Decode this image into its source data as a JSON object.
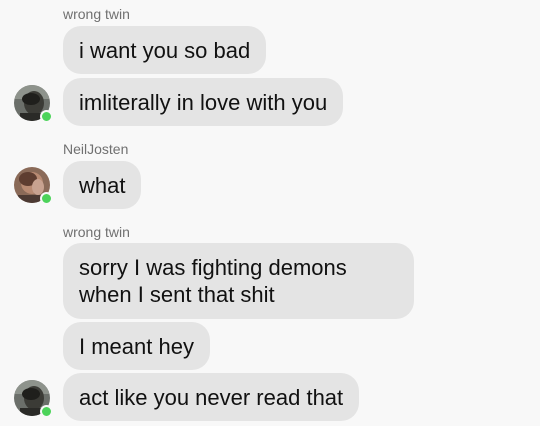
{
  "messages": [
    {
      "sender": "wrong twin"
    },
    {
      "text": "i want you so bad"
    },
    {
      "text": "imliterally in love with you"
    },
    {
      "sender": "NeilJosten"
    },
    {
      "text": "what"
    },
    {
      "sender": "wrong twin"
    },
    {
      "text": "sorry I was fighting demons when I sent that shit"
    },
    {
      "text": "I meant hey"
    },
    {
      "text": "act like you never read that"
    }
  ],
  "avatars": {
    "wrong_twin_icon": "dark-portrait-avatar",
    "neil_icon": "brown-portrait-avatar"
  },
  "colors": {
    "background": "#f8f8f8",
    "bubble": "#e4e4e4",
    "online_dot": "#4cd35a",
    "sender_text": "#707070"
  }
}
